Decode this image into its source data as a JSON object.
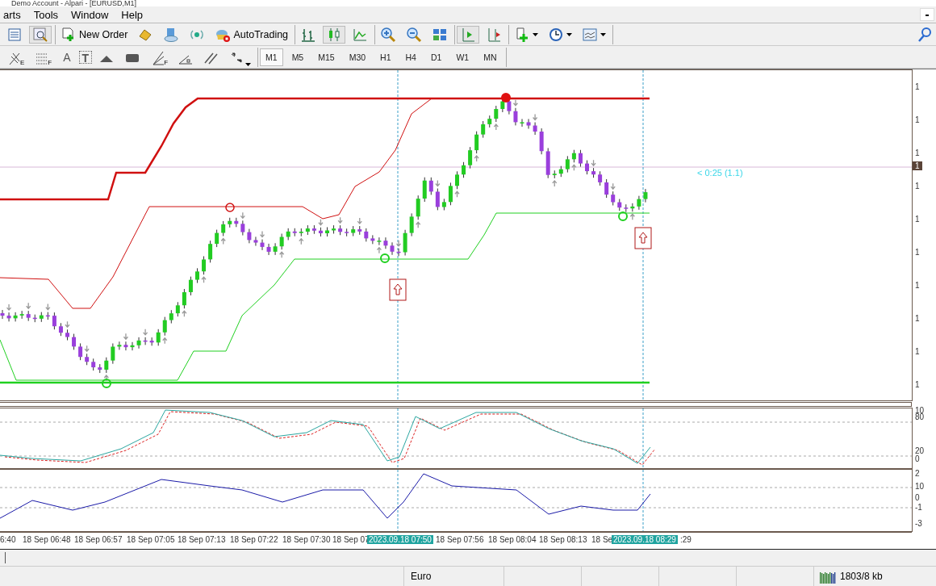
{
  "window": {
    "title": "Demo Account - Alpari - [EURUSD,M1]"
  },
  "menu": [
    {
      "label": "arts"
    },
    {
      "label": "Tools"
    },
    {
      "label": "Window"
    },
    {
      "label": "Help"
    }
  ],
  "toolbar": {
    "new_order": "New Order",
    "auto_trading": "AutoTrading"
  },
  "drawing_tools": {
    "subscripts": [
      "E",
      "F",
      "F"
    ],
    "text_tool": "A",
    "text_label_tool": "T"
  },
  "timeframes": [
    {
      "label": "M1",
      "selected": true
    },
    {
      "label": "M5",
      "selected": false
    },
    {
      "label": "M15",
      "selected": false
    },
    {
      "label": "M30",
      "selected": false
    },
    {
      "label": "H1",
      "selected": false
    },
    {
      "label": "H4",
      "selected": false
    },
    {
      "label": "D1",
      "selected": false
    },
    {
      "label": "W1",
      "selected": false
    },
    {
      "label": "MN",
      "selected": false
    }
  ],
  "chart": {
    "price_labels": [
      "1",
      "1",
      "1",
      "1",
      "1",
      "1",
      "1",
      "1",
      "1",
      "1"
    ],
    "price_tag": "1",
    "countdown": "< 0:25 (1.1)",
    "stochastic_labels": [
      "10",
      "80",
      "20",
      "0"
    ],
    "oscillator_labels": [
      "2",
      "10",
      "0",
      "-1",
      "-3"
    ],
    "time_labels": [
      {
        "label": "6:40",
        "highlighted": false
      },
      {
        "label": "18 Sep 06:48",
        "highlighted": false
      },
      {
        "label": "18 Sep 06:57",
        "highlighted": false
      },
      {
        "label": "18 Sep 07:05",
        "highlighted": false
      },
      {
        "label": "18 Sep 07:13",
        "highlighted": false
      },
      {
        "label": "18 Sep 07:22",
        "highlighted": false
      },
      {
        "label": "18 Sep 07:30",
        "highlighted": false
      },
      {
        "label": "18 Sep 07",
        "highlighted": false
      },
      {
        "label": "2023.09.18 07:50",
        "highlighted": true
      },
      {
        "label": "18 Sep 07:56",
        "highlighted": false
      },
      {
        "label": "18 Sep 08:04",
        "highlighted": false
      },
      {
        "label": "18 Sep 08:13",
        "highlighted": false
      },
      {
        "label": "18 Se",
        "highlighted": false
      },
      {
        "label": "2023.09.18 08:29",
        "highlighted": true
      },
      {
        "label": ":29",
        "highlighted": false
      }
    ]
  },
  "status_bar": {
    "connection": "Euro",
    "traffic": "1803/8 kb"
  }
}
